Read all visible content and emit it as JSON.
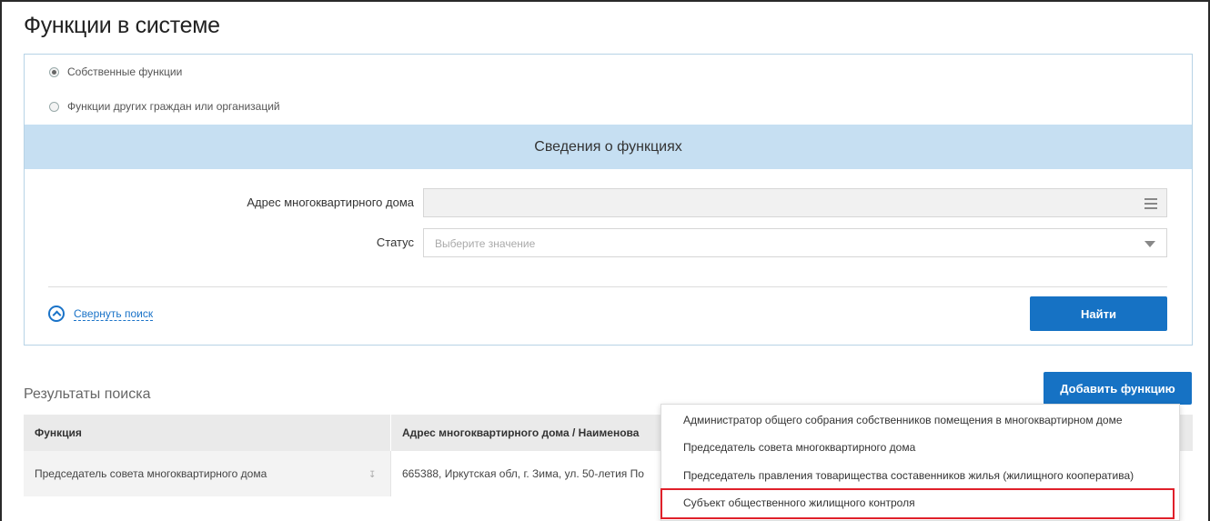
{
  "page": {
    "title": "Функции в системе"
  },
  "filters": {
    "radio_options": [
      {
        "label": "Собственные функции",
        "checked": true
      },
      {
        "label": "Функции других граждан или организаций",
        "checked": false
      }
    ],
    "section_title": "Сведения о функциях",
    "address_label": "Адрес многоквартирного дома",
    "address_value": "",
    "status_label": "Статус",
    "status_placeholder": "Выберите значение",
    "collapse_label": "Свернуть поиск",
    "find_button": "Найти"
  },
  "results": {
    "title": "Результаты поиска",
    "add_button": "Добавить функцию",
    "columns": [
      "Функция",
      "Адрес многоквартирного дома / Наименова"
    ],
    "rows": [
      {
        "function": "Председатель совета многоквартирного дома",
        "address": "665388, Иркутская обл, г. Зима, ул. 50-летия По"
      }
    ]
  },
  "add_menu": {
    "items": [
      "Администратор общего собрания собственников помещения в многоквартирном доме",
      "Председатель совета многоквартирного дома",
      "Председатель правления товарищества составенников жилья (жилищного кооператива)",
      "Субъект общественного жилищного контроля"
    ],
    "highlighted_index": 3
  },
  "colors": {
    "accent": "#1672c4",
    "section_bg": "#c6dff2",
    "highlight": "#e0202a"
  }
}
